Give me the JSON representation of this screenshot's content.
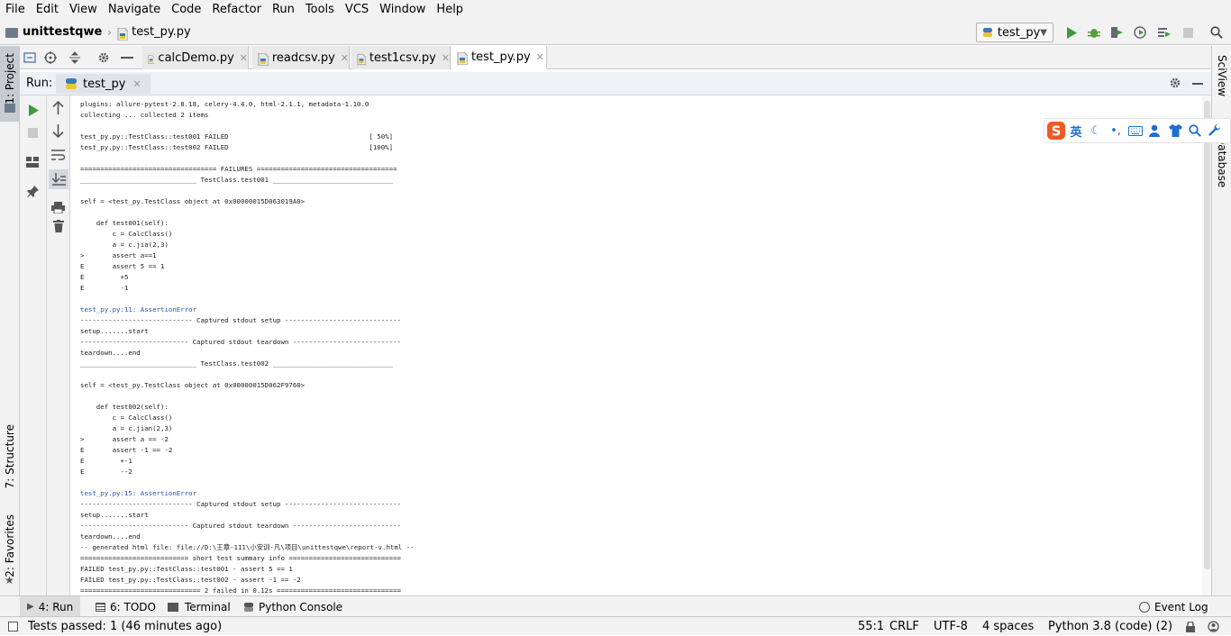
{
  "menubar": {
    "items": [
      "File",
      "Edit",
      "View",
      "Navigate",
      "Code",
      "Refactor",
      "Run",
      "Tools",
      "VCS",
      "Window",
      "Help"
    ]
  },
  "navbar": {
    "project": "unittestqwe",
    "file": "test_py.py",
    "run_config": "test_py"
  },
  "left_tool_windows": {
    "project": "1: Project",
    "structure": "7: Structure",
    "favorites": "2: Favorites"
  },
  "right_tool_windows": {
    "sciview": "SciView",
    "database": "Database"
  },
  "editor_tabs": [
    {
      "label": "calcDemo.py",
      "active": false
    },
    {
      "label": "readcsv.py",
      "active": false
    },
    {
      "label": "test1csv.py",
      "active": false
    },
    {
      "label": "test_py.py",
      "active": true
    }
  ],
  "run_panel": {
    "label": "Run:",
    "tab": "test_py"
  },
  "console_lines": [
    {
      "text": "plugins: allure-pytest-2.8.18, celery-4.4.0, html-2.1.1, metadata-1.10.0",
      "link": false
    },
    {
      "text": "collecting ... collected 2 items",
      "link": false
    },
    {
      "text": "",
      "link": false
    },
    {
      "text": "test_py.py::TestClass::test001 FAILED                                   [ 50%]",
      "link": false
    },
    {
      "text": "test_py.py::TestClass::test002 FAILED                                   [100%]",
      "link": false
    },
    {
      "text": "",
      "link": false
    },
    {
      "text": "================================== FAILURES ===================================",
      "link": false
    },
    {
      "text": "_____________________________ TestClass.test001 ______________________________",
      "link": false
    },
    {
      "text": "",
      "link": false
    },
    {
      "text": "self = <test_py.TestClass object at 0x00000015D063019A0>",
      "link": false
    },
    {
      "text": "",
      "link": false
    },
    {
      "text": "    def test001(self):",
      "link": false
    },
    {
      "text": "        c = CalcClass()",
      "link": false
    },
    {
      "text": "        a = c.jia(2,3)",
      "link": false
    },
    {
      "text": ">       assert a==1",
      "link": false
    },
    {
      "text": "E       assert 5 == 1",
      "link": false
    },
    {
      "text": "E         +5",
      "link": false
    },
    {
      "text": "E         -1",
      "link": false
    },
    {
      "text": "",
      "link": false
    },
    {
      "text": "test_py.py:11: AssertionError",
      "link": true
    },
    {
      "text": "---------------------------- Captured stdout setup -----------------------------",
      "link": false
    },
    {
      "text": "setup.......start",
      "link": false
    },
    {
      "text": "--------------------------- Captured stdout teardown ---------------------------",
      "link": false
    },
    {
      "text": "teardown....end",
      "link": false
    },
    {
      "text": "_____________________________ TestClass.test002 ______________________________",
      "link": false
    },
    {
      "text": "",
      "link": false
    },
    {
      "text": "self = <test_py.TestClass object at 0x00000015D062F9760>",
      "link": false
    },
    {
      "text": "",
      "link": false
    },
    {
      "text": "    def test002(self):",
      "link": false
    },
    {
      "text": "        c = CalcClass()",
      "link": false
    },
    {
      "text": "        a = c.jian(2,3)",
      "link": false
    },
    {
      "text": ">       assert a == -2",
      "link": false
    },
    {
      "text": "E       assert -1 == -2",
      "link": false
    },
    {
      "text": "E         +-1",
      "link": false
    },
    {
      "text": "E         --2",
      "link": false
    },
    {
      "text": "",
      "link": false
    },
    {
      "text": "test_py.py:15: AssertionError",
      "link": true
    },
    {
      "text": "---------------------------- Captured stdout setup -----------------------------",
      "link": false
    },
    {
      "text": "setup.......start",
      "link": false
    },
    {
      "text": "--------------------------- Captured stdout teardown ---------------------------",
      "link": false
    },
    {
      "text": "teardown....end",
      "link": false
    },
    {
      "text": "-- generated html file: file://D:\\王章-111\\小安训-凡\\项目\\unittestqwe\\report-v.html --",
      "link": false
    },
    {
      "text": "=========================== short test summary info ============================",
      "link": false
    },
    {
      "text": "FAILED test_py.py::TestClass::test001 - assert 5 == 1",
      "link": false
    },
    {
      "text": "FAILED test_py.py::TestClass::test002 - assert -1 == -2",
      "link": false
    },
    {
      "text": "============================== 2 failed in 0.12s ===============================",
      "link": false
    }
  ],
  "ime_toolbar": {
    "lang": "英"
  },
  "bottom_tabs": [
    {
      "label": "4: Run",
      "active": true
    },
    {
      "label": "6: TODO",
      "active": false
    },
    {
      "label": "Terminal",
      "active": false
    },
    {
      "label": "Python Console",
      "active": false
    }
  ],
  "event_log": "Event Log",
  "statusbar": {
    "message": "Tests passed: 1 (46 minutes ago)",
    "position": "55:1",
    "line_sep": "CRLF",
    "encoding": "UTF-8",
    "indent": "4 spaces",
    "interpreter": "Python 3.8 (code) (2)"
  },
  "colors": {
    "run_green": "#3c9a3c",
    "link_blue": "#2a55b8",
    "ime_orange": "#f05a22"
  }
}
